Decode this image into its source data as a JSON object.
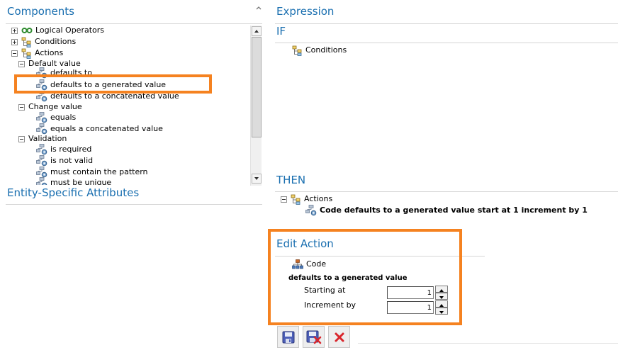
{
  "components": {
    "title": "Components",
    "tree": [
      {
        "label": "Logical Operators"
      },
      {
        "label": "Conditions"
      },
      {
        "label": "Actions"
      },
      {
        "label": "Default value"
      },
      {
        "label": "defaults to"
      },
      {
        "label": "defaults to a generated value"
      },
      {
        "label": "defaults to a concatenated value"
      },
      {
        "label": "Change value"
      },
      {
        "label": "equals"
      },
      {
        "label": "equals a concatenated value"
      },
      {
        "label": "Validation"
      },
      {
        "label": "is required"
      },
      {
        "label": "is not valid"
      },
      {
        "label": "must contain the pattern"
      },
      {
        "label": "must be unique"
      }
    ]
  },
  "entity_attrs": {
    "title": "Entity-Specific Attributes"
  },
  "expression": {
    "title": "Expression",
    "if_label": "IF",
    "if_node": "Conditions",
    "then_label": "THEN",
    "then_node": "Actions",
    "then_child": "Code defaults to a generated value start at 1 increment by 1"
  },
  "edit_action": {
    "title": "Edit Action",
    "field_label": "Code",
    "action_label": "defaults to a generated value",
    "starting_at_label": "Starting at",
    "starting_at_value": "1",
    "increment_label": "Increment by",
    "increment_value": "1"
  },
  "toolbar": {
    "save_icon": "save-icon",
    "save_close_icon": "save-and-close-icon",
    "cancel_icon": "cancel-icon"
  },
  "colors": {
    "heading": "#1a6fb0",
    "highlight": "#f58220",
    "cancel_red": "#d9262c"
  }
}
